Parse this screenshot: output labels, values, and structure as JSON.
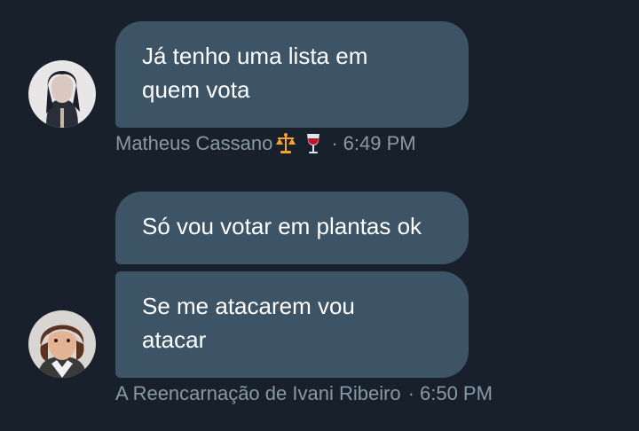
{
  "conversation": {
    "group1": {
      "messages": [
        {
          "text": "Já tenho uma lista em\nquem vota"
        }
      ],
      "sender": "Matheus Cassano",
      "sender_emojis": [
        "scales-emoji",
        "wine-glass-emoji"
      ],
      "separator": "·",
      "time": "6:49 PM"
    },
    "group2": {
      "messages": [
        {
          "text": "Só vou votar em plantas ok"
        },
        {
          "text": "Se me atacarem vou\natacar"
        }
      ],
      "sender": "A Reencarnação de Ivani Ribeiro",
      "separator": "·",
      "time": "6:50 PM"
    }
  },
  "colors": {
    "background": "#18212b",
    "bubble": "#3d5366",
    "meta_text": "#8899a6",
    "message_text": "#ffffff"
  }
}
